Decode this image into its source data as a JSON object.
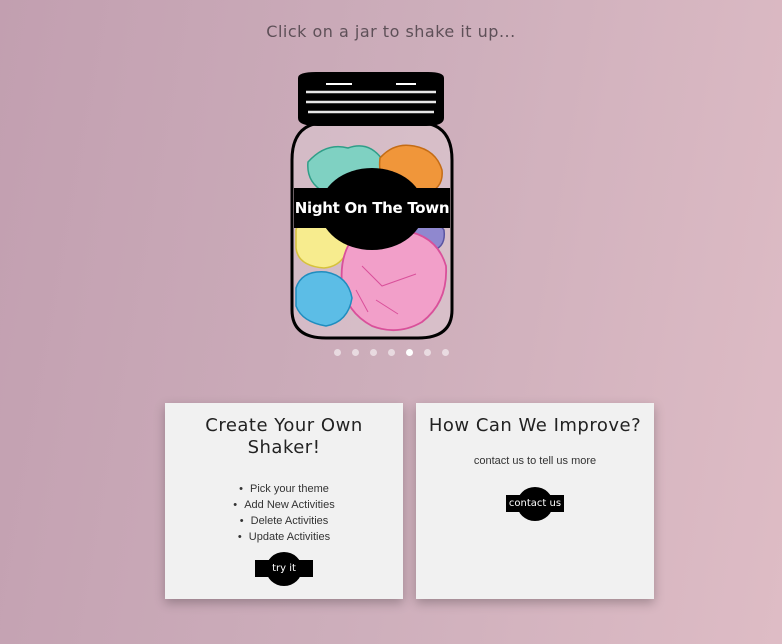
{
  "header": {
    "instruction": "Click on a jar to shake it up..."
  },
  "jar": {
    "label": "Night On The Town"
  },
  "carousel": {
    "dot_count": 7,
    "active_index": 4
  },
  "card_create": {
    "title": "Create Your Own Shaker!",
    "items": [
      "Pick your theme",
      "Add New Activities",
      "Delete Activities",
      "Update Activities"
    ],
    "button_label": "try it"
  },
  "card_improve": {
    "title": "How Can We Improve?",
    "text": "contact us to tell us more",
    "button_label": "contact us"
  },
  "colors": {
    "teal": "#7fd1c2",
    "orange": "#f0963a",
    "yellow": "#f7ec8e",
    "blue": "#5cbde6",
    "pink": "#f29fc9",
    "purple": "#8f88cf"
  }
}
